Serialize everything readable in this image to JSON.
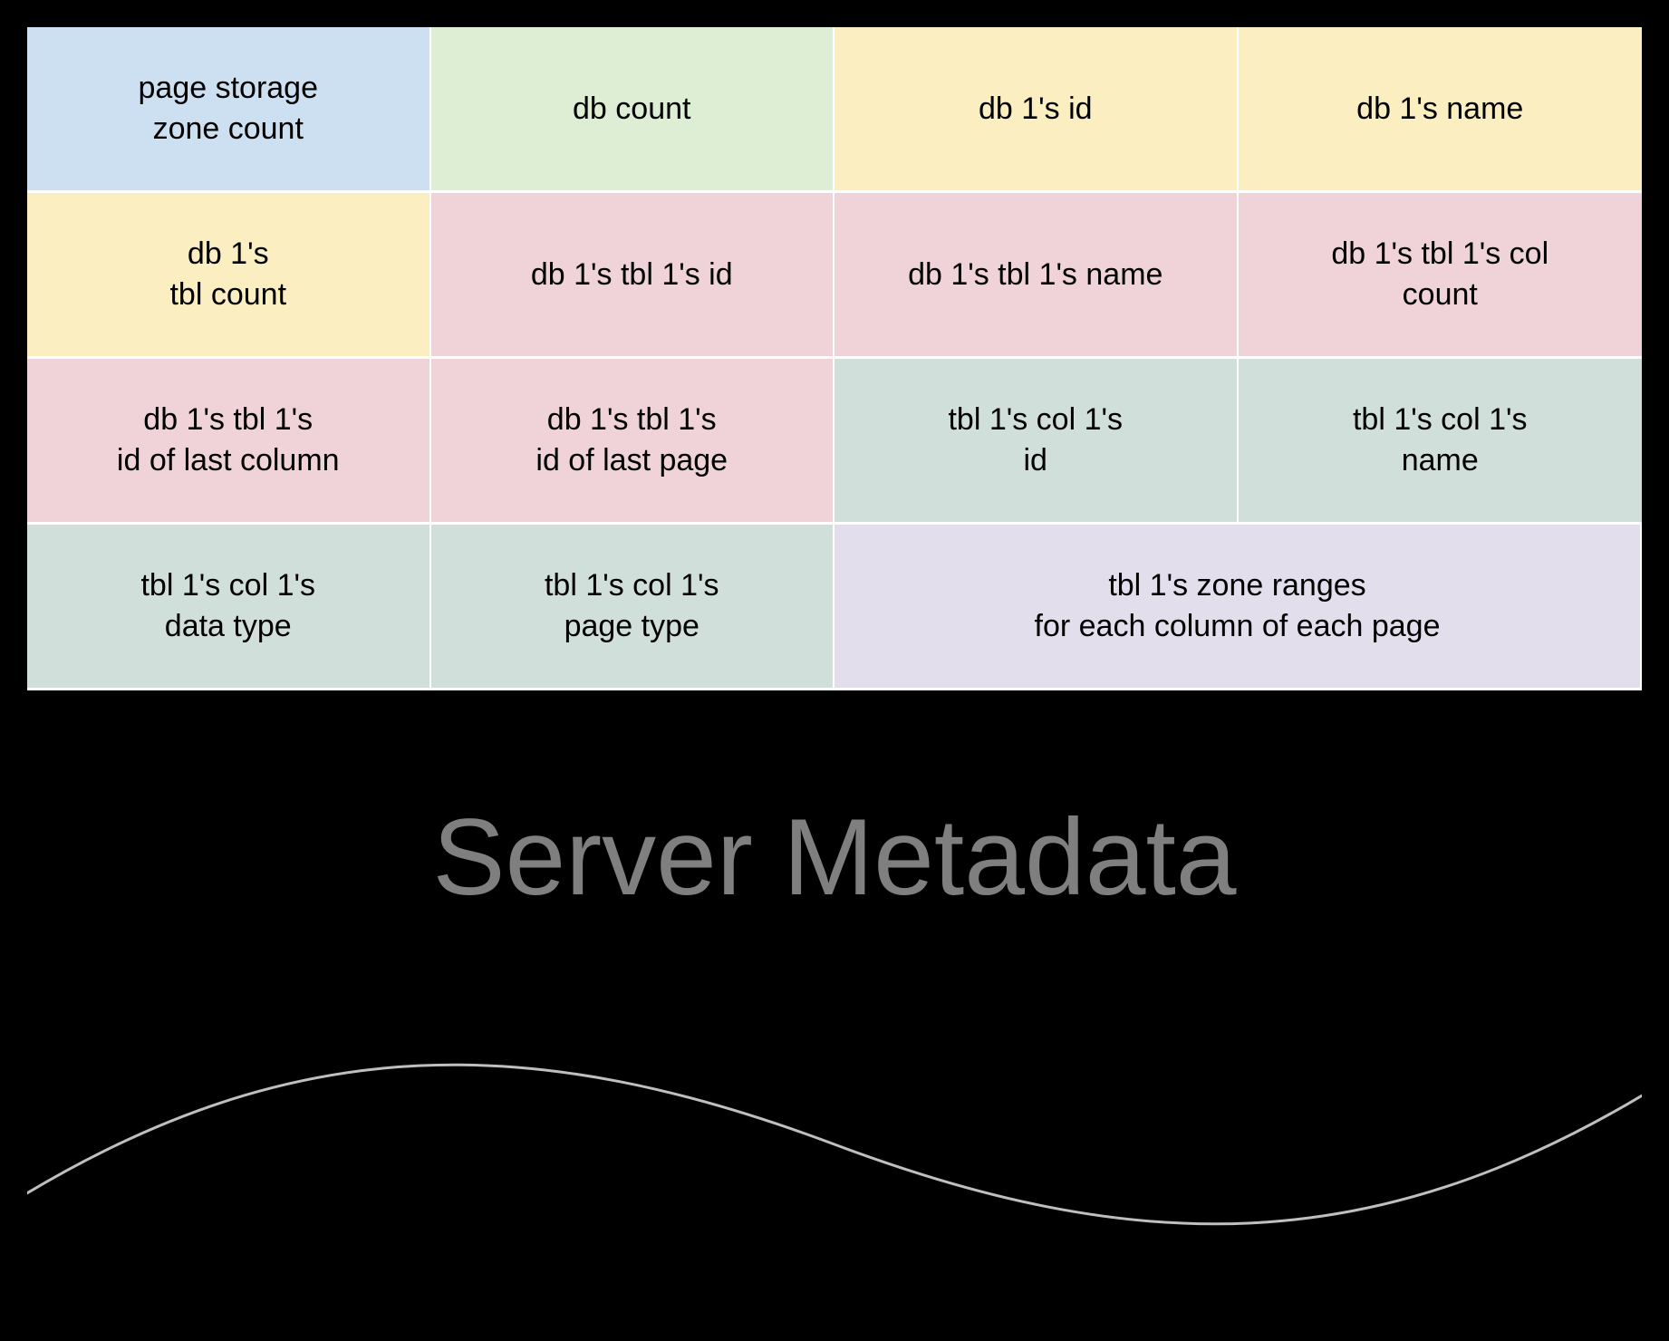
{
  "colors": {
    "blue": "#CDE0F2",
    "green": "#DEEED4",
    "yellow": "#FBEEC1",
    "pink": "#EFD3D8",
    "teal": "#D1DFDB",
    "lavender": "#E2DEEB"
  },
  "footer": {
    "title": "Server Metadata"
  },
  "grid": {
    "rows": [
      [
        {
          "text": "page storage\nzone count",
          "color": "blue"
        },
        {
          "text": "db count",
          "color": "green"
        },
        {
          "text": "db 1's id",
          "color": "yellow"
        },
        {
          "text": "db 1's name",
          "color": "yellow"
        }
      ],
      [
        {
          "text": "db 1's\ntbl count",
          "color": "yellow"
        },
        {
          "text": "db 1's tbl 1's id",
          "color": "pink"
        },
        {
          "text": "db 1's  tbl 1's name",
          "color": "pink"
        },
        {
          "text": "db 1's tbl 1's col\ncount",
          "color": "pink"
        }
      ],
      [
        {
          "text": "db 1's tbl 1's\nid of last column",
          "color": "pink"
        },
        {
          "text": "db 1's tbl 1's\nid of last page",
          "color": "pink"
        },
        {
          "text": "tbl 1's col 1's\nid",
          "color": "teal"
        },
        {
          "text": "tbl 1's col 1's\nname",
          "color": "teal"
        }
      ],
      [
        {
          "text": "tbl 1's col 1's\ndata type",
          "color": "teal"
        },
        {
          "text": "tbl 1's col 1's\npage type",
          "color": "teal"
        },
        {
          "text": "tbl 1's zone ranges\nfor each column of each page",
          "color": "lavender",
          "span": 2
        }
      ]
    ]
  }
}
